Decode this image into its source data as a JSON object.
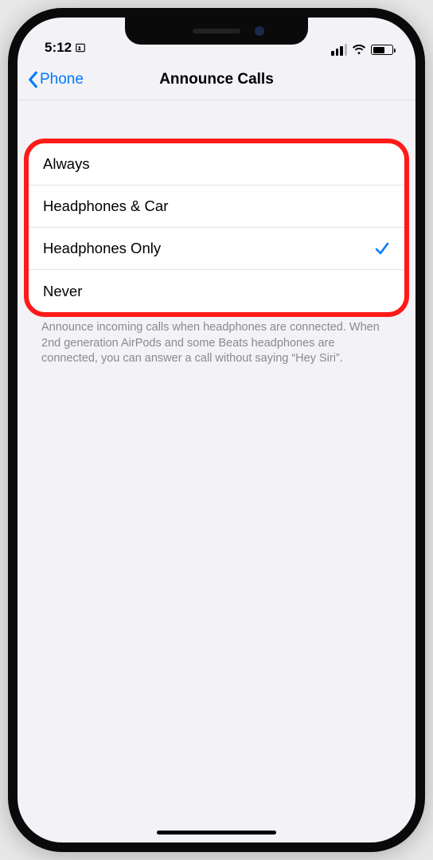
{
  "status": {
    "time": "5:12"
  },
  "nav": {
    "back_label": "Phone",
    "title": "Announce Calls"
  },
  "options": [
    {
      "label": "Always",
      "selected": false
    },
    {
      "label": "Headphones & Car",
      "selected": false
    },
    {
      "label": "Headphones Only",
      "selected": true
    },
    {
      "label": "Never",
      "selected": false
    }
  ],
  "footer": "Announce incoming calls when headphones are connected. When 2nd generation AirPods and some Beats headphones are connected, you can answer a call without saying “Hey Siri”."
}
